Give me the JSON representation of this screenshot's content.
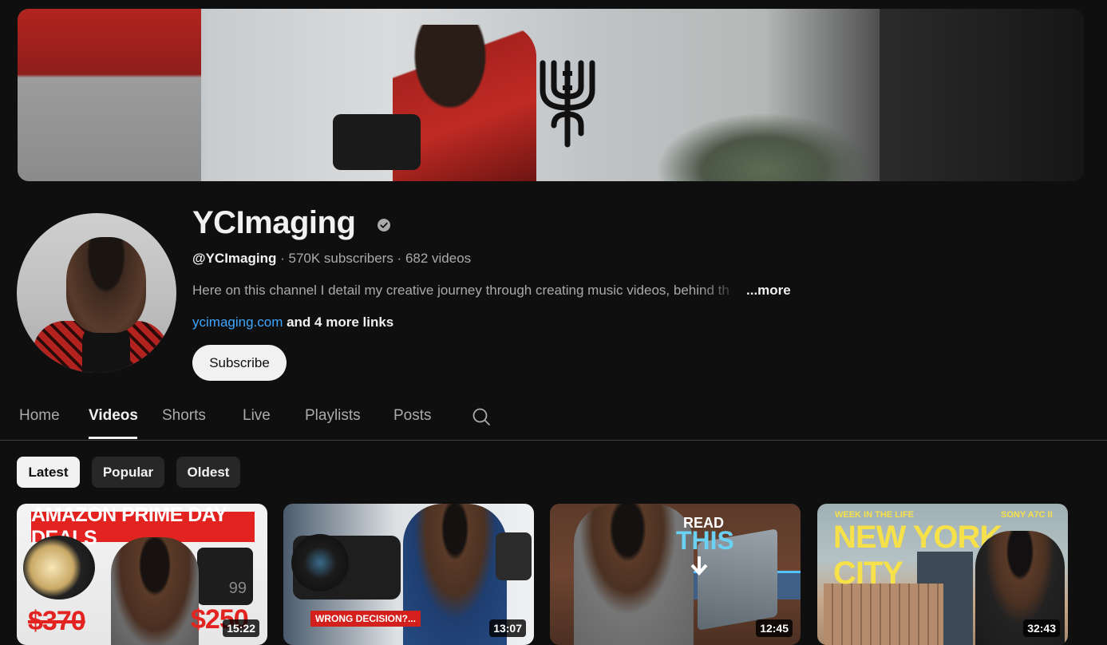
{
  "channel": {
    "name": "YCImaging",
    "handle": "@YCImaging",
    "subscribers": "570K subscribers",
    "videos_count": "682 videos",
    "separator": " · ",
    "description": "Here on this channel I detail my creative journey through creating music videos, behind th",
    "more_label": "...more",
    "link": "ycimaging.com",
    "more_links": " and 4 more links",
    "subscribe_label": "Subscribe"
  },
  "tabs": [
    "Home",
    "Videos",
    "Shorts",
    "Live",
    "Playlists",
    "Posts"
  ],
  "active_tab": "Videos",
  "chips": [
    "Latest",
    "Popular",
    "Oldest"
  ],
  "active_chip": "Latest",
  "videos": [
    {
      "duration": "15:22",
      "thumb_text": "AMAZON PRIME DAY DEALS",
      "price_old": "$370",
      "price_new": "$250",
      "device_digits": "99"
    },
    {
      "duration": "13:07",
      "thumb_text": "WRONG DECISION?..."
    },
    {
      "duration": "12:45",
      "thumb_line1": "READ",
      "thumb_line2": "THIS"
    },
    {
      "duration": "32:43",
      "thumb_small_left": "WEEK IN THE LIFE",
      "thumb_small_right": "SONY A7C II",
      "thumb_title": "NEW YORK CITY"
    }
  ],
  "colors": {
    "background": "#0f0f0f",
    "link": "#3ea6ff",
    "chip_active": "#f1f1f1",
    "chip": "#272727"
  }
}
